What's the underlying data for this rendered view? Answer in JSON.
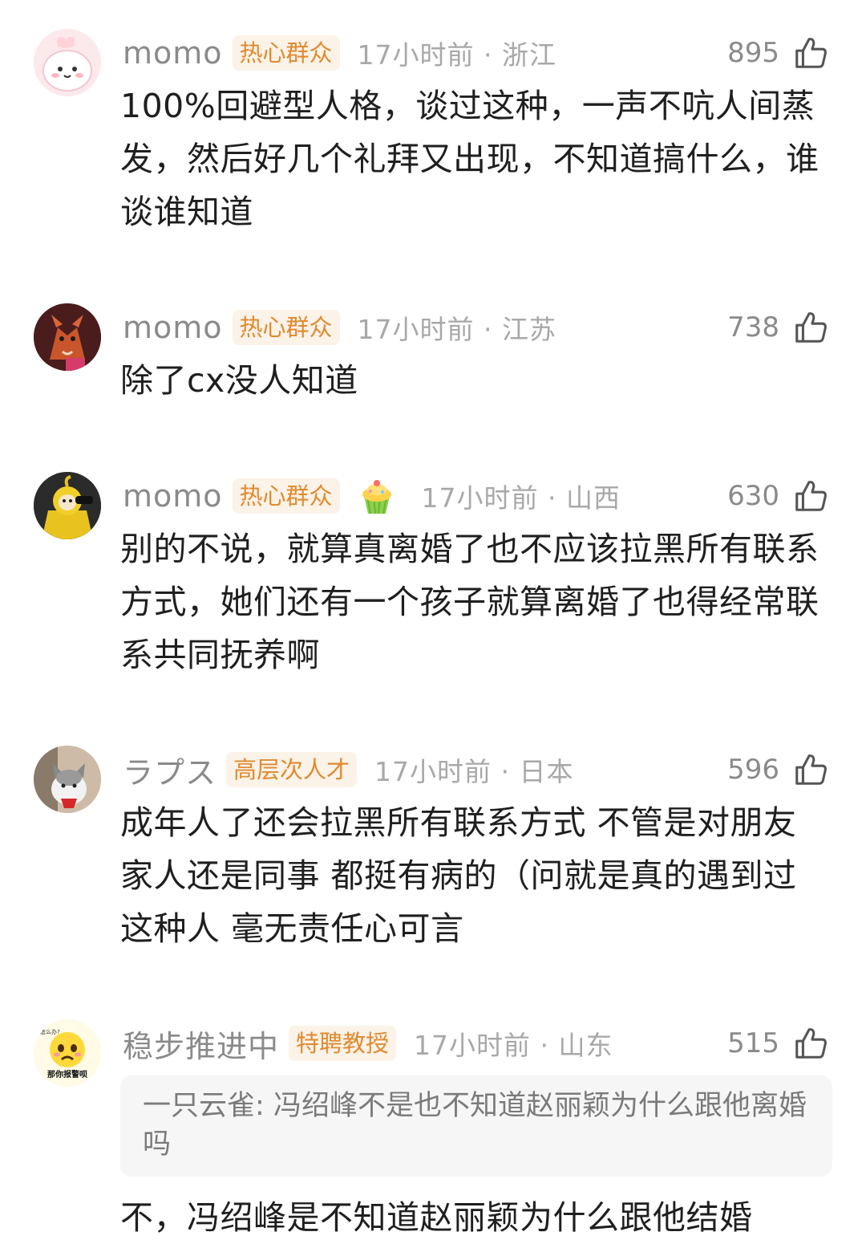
{
  "comments": [
    {
      "username": "momo",
      "badge": "热心群众",
      "time": "17小时前 · 浙江",
      "likes": "895",
      "avatar": "pink-bunny-avatar",
      "text": "100%回避型人格，谈过这种，一声不吭人间蒸发，然后好几个礼拜又出现，不知道搞什么，谁谈谁知道"
    },
    {
      "username": "momo",
      "badge": "热心群众",
      "time": "17小时前 · 江苏",
      "likes": "738",
      "avatar": "fox-character-avatar",
      "text": "除了cx没人知道"
    },
    {
      "username": "momo",
      "badge": "热心群众",
      "time": "17小时前 · 山西",
      "likes": "630",
      "avatar": "teletubby-avatar",
      "extra_icon": "cupcake-icon",
      "text": "别的不说，就算真离婚了也不应该拉黑所有联系方式，她们还有一个孩子就算离婚了也得经常联系共同抚养啊"
    },
    {
      "username": "ラプス",
      "badge": "高层次人才",
      "time": "17小时前 · 日本",
      "likes": "596",
      "avatar": "cat-avatar",
      "text": "成年人了还会拉黑所有联系方式 不管是对朋友家人还是同事 都挺有病的（问就是真的遇到过这种人 毫无责任心可言"
    },
    {
      "username": "稳步推进中",
      "badge": "特聘教授",
      "time": "17小时前 · 山东",
      "likes": "515",
      "avatar": "crying-emoji-avatar",
      "avatar_text": "那你报警呗",
      "avatar_small_text": "怎么办?",
      "quote_name": "一只云雀:",
      "quote_text": "冯绍峰不是也不知道赵丽颖为什么跟他离婚吗",
      "text": "不，冯绍峰是不知道赵丽颖为什么跟他结婚"
    }
  ]
}
